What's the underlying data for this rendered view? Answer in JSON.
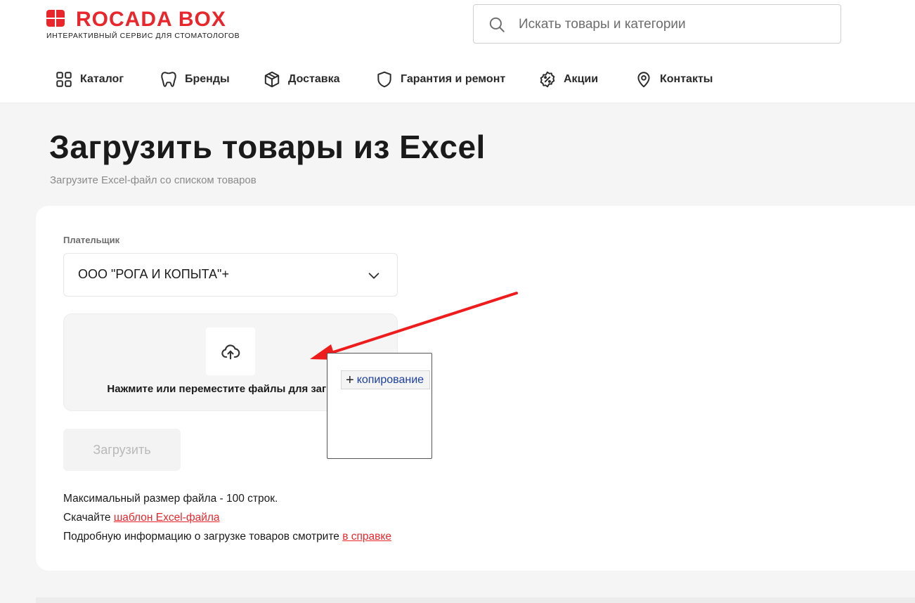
{
  "brand": {
    "name": "ROCADA BOX",
    "tagline": "ИНТЕРАКТИВНЫЙ СЕРВИС ДЛЯ СТОМАТОЛОГОВ",
    "accent_color": "#e8262c"
  },
  "search": {
    "placeholder": "Искать товары и категории",
    "value": "",
    "icon": "search-icon"
  },
  "nav": {
    "items": [
      {
        "label": "Каталог",
        "icon": "grid-icon"
      },
      {
        "label": "Бренды",
        "icon": "tooth-icon"
      },
      {
        "label": "Доставка",
        "icon": "box-icon"
      },
      {
        "label": "Гарантия и ремонт",
        "icon": "shield-icon"
      },
      {
        "label": "Акции",
        "icon": "discount-icon"
      },
      {
        "label": "Контакты",
        "icon": "location-pin-icon"
      }
    ]
  },
  "page": {
    "title": "Загрузить товары из Excel",
    "subtitle": "Загрузите Excel-файл со списком товаров"
  },
  "form": {
    "payer_label": "Плательщик",
    "payer_value": "ООО \"РОГА И КОПЫТА\"+",
    "dropzone_text": "Нажмите или переместите файлы для загрузки",
    "upload_button": "Загрузить",
    "upload_icon": "cloud-upload-icon"
  },
  "info": {
    "line1": "Максимальный размер файла - 100 строк.",
    "line2_prefix": "Скачайте ",
    "line2_link": "шаблон Excel-файла",
    "line3_prefix": "Подробную информацию о загрузке товаров смотрите ",
    "line3_link": "в справке"
  },
  "drag_overlay": {
    "tooltip": "копирование",
    "arrow_color": "#ee1c1c"
  }
}
